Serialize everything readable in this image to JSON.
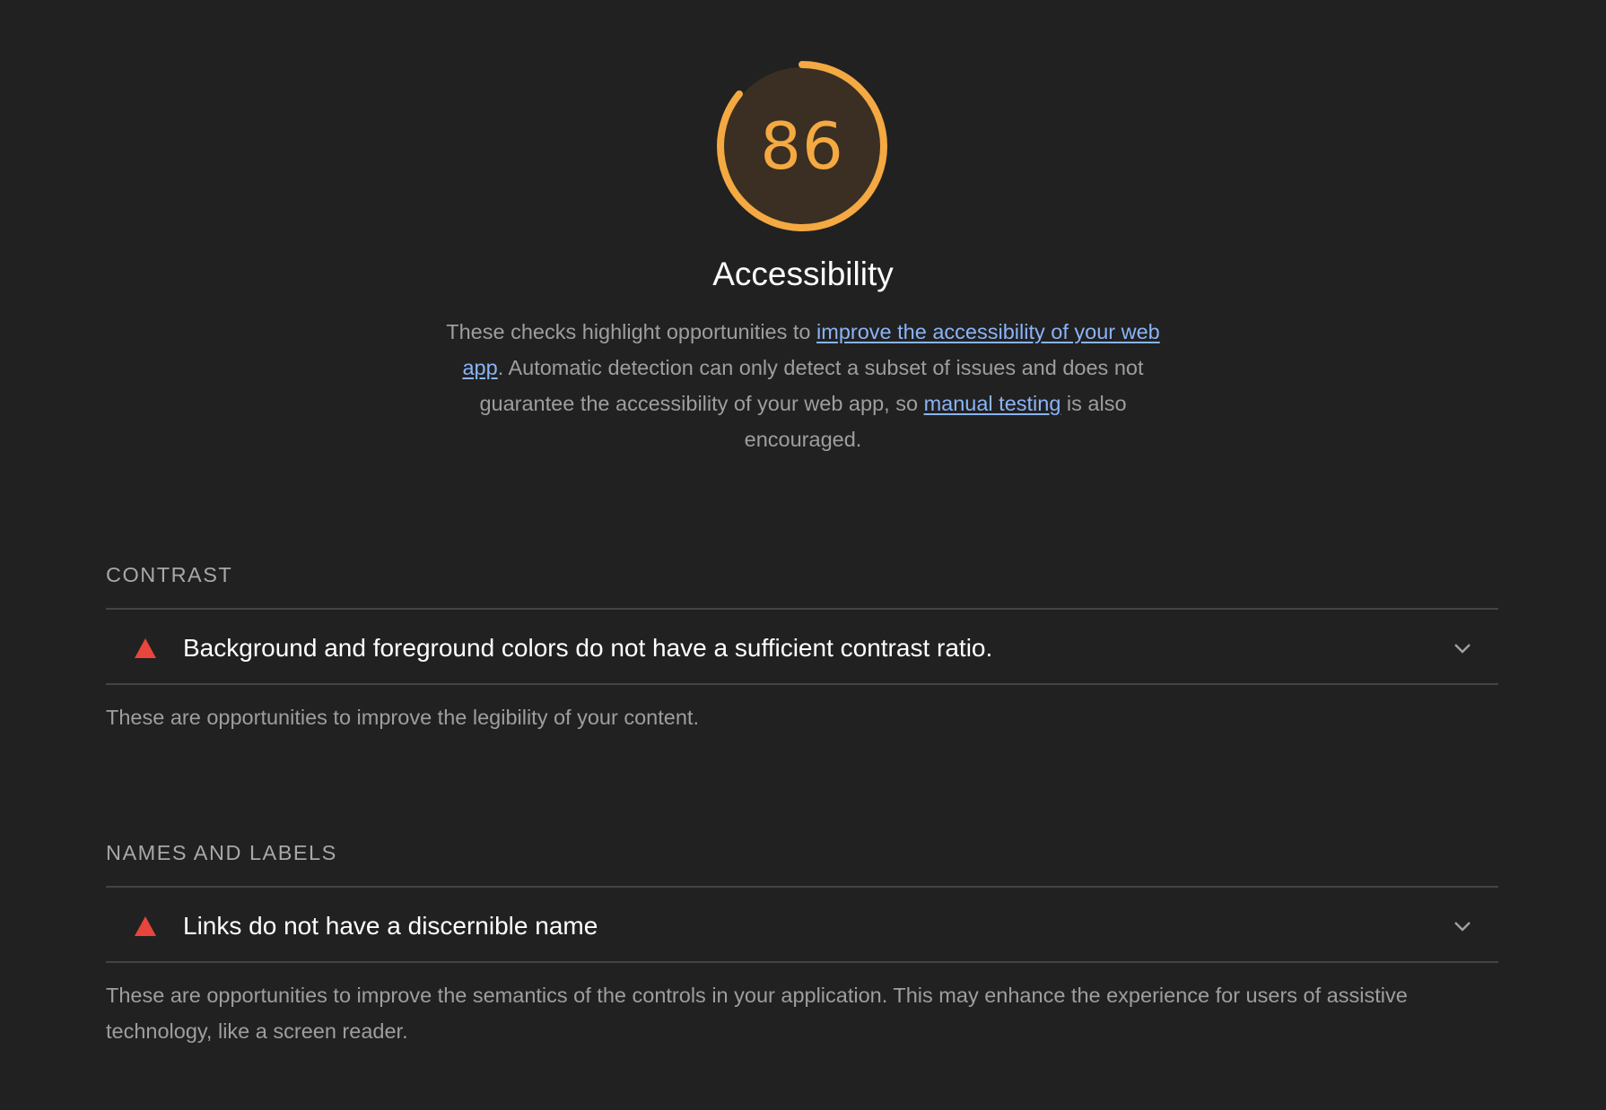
{
  "category": {
    "score": "86",
    "score_fraction": 0.86,
    "title": "Accessibility",
    "description": {
      "text_1": "These checks highlight opportunities to ",
      "link_1": "improve the accessibility of your web app",
      "text_2": ". Automatic detection can only detect a subset of issues and does not guarantee the accessibility of your web app, so ",
      "link_2": "manual testing",
      "text_3": " is also encouraged."
    }
  },
  "groups": [
    {
      "title": "CONTRAST",
      "audit": "Background and foreground colors do not have a sufficient contrast ratio.",
      "description": "These are opportunities to improve the legibility of your content."
    },
    {
      "title": "NAMES AND LABELS",
      "audit": "Links do not have a discernible name",
      "description": "These are opportunities to improve the semantics of the controls in your application. This may enhance the experience for users of assistive technology, like a screen reader."
    }
  ],
  "colors": {
    "score_average": "#f4a942",
    "score_bg": "#3a2f22",
    "fail": "#e8453c",
    "link": "#8ab4f8"
  },
  "icons": {
    "audit_status": "warning-triangle-icon",
    "expand": "chevron-down-icon"
  }
}
